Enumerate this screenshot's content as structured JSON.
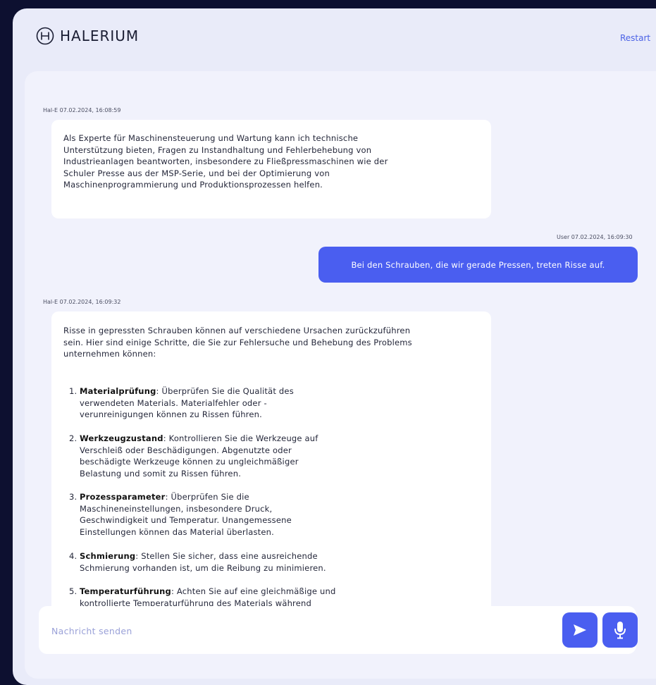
{
  "app": {
    "logo_text": "HALERIUM",
    "restart_label": "Restart"
  },
  "messages": [
    {
      "sender": "Hal-E",
      "meta": "Hal-E 07.02.2024, 16:08:59",
      "lines": [
        "Als Experte für Maschinensteuerung und Wartung kann ich technische",
        "Unterstützung bieten, Fragen zu Instandhaltung und Fehlerbehebung von",
        "Industrieanlagen beantworten, insbesondere zu Fließpressmaschinen wie der",
        "Schuler Presse aus der MSP-Serie, und bei der Optimierung von",
        "Maschinenprogrammierung und Produktionsprozessen helfen."
      ]
    },
    {
      "sender": "User",
      "meta": "User 07.02.2024, 16:09:30",
      "text": "Bei den Schrauben, die wir gerade Pressen, treten Risse auf."
    },
    {
      "sender": "Hal-E",
      "meta": "Hal-E 07.02.2024, 16:09:32",
      "intro_lines": [
        "Risse in gepressten Schrauben können auf verschiedene Ursachen zurückzuführen",
        "sein. Hier sind einige Schritte, die Sie zur Fehlersuche und Behebung des Problems",
        "unternehmen können:"
      ],
      "items": [
        {
          "num": "1.",
          "title": "Materialprüfung",
          "lines": [
            ": Überprüfen Sie die Qualität des",
            "verwendeten Materials. Materialfehler oder -",
            "verunreinigungen können zu Rissen führen."
          ]
        },
        {
          "num": "2.",
          "title": "Werkzeugzustand",
          "lines": [
            ": Kontrollieren Sie die Werkzeuge auf",
            "Verschleiß oder Beschädigungen. Abgenutzte oder",
            "beschädigte Werkzeuge können zu ungleichmäßiger",
            "Belastung und somit zu Rissen führen."
          ]
        },
        {
          "num": "3.",
          "title": "Prozessparameter",
          "lines": [
            ": Überprüfen Sie die",
            "Maschineneinstellungen, insbesondere Druck,",
            "Geschwindigkeit und Temperatur. Unangemessene",
            "Einstellungen können das Material überlasten."
          ]
        },
        {
          "num": "4.",
          "title": "Schmierung",
          "lines": [
            ": Stellen Sie sicher, dass eine ausreichende",
            "Schmierung vorhanden ist, um die Reibung zu minimieren."
          ]
        },
        {
          "num": "5.",
          "title": "Temperaturführung",
          "lines": [
            ": Achten Sie auf eine gleichmäßige und",
            "kontrollierte Temperaturführung des Materials während"
          ]
        }
      ]
    }
  ],
  "composer": {
    "placeholder": "Nachricht senden"
  },
  "icons": {
    "send": "send-icon",
    "mic": "microphone-icon",
    "logo": "halerium-logo-icon"
  },
  "colors": {
    "accent": "#4a5ef0",
    "background": "#0d1030",
    "panel": "#e9ebf9"
  }
}
